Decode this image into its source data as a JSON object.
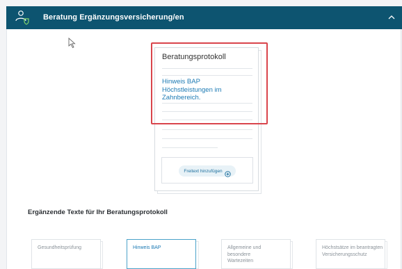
{
  "header": {
    "title": "Beratung Ergänzungsversicherung/en",
    "icon": "user-shield-icon",
    "chevron": "chevron-up-icon",
    "background": "#0d5470"
  },
  "protocol": {
    "title": "Beratungsprotokoll",
    "link_text": "Hinweis BAP Höchstleistungen im Zahnbereich.",
    "add_button_label": "Freitext hinzufügen",
    "add_icon": "plus-circle-icon"
  },
  "section": {
    "title": "Ergänzende Texte für Ihr Beratungsprotokoll"
  },
  "tiles": [
    {
      "label": "Gesundheitsprüfung",
      "active": false
    },
    {
      "label": "Hinweis BAP",
      "active": true
    },
    {
      "label": "Allgemeine und besondere Wartezeiten",
      "active": false
    },
    {
      "label": "Höchstsätze im beantragten Versicherungsschutz",
      "active": false
    }
  ],
  "colors": {
    "accent": "#1c7ab4",
    "highlight": "#d9444b"
  }
}
